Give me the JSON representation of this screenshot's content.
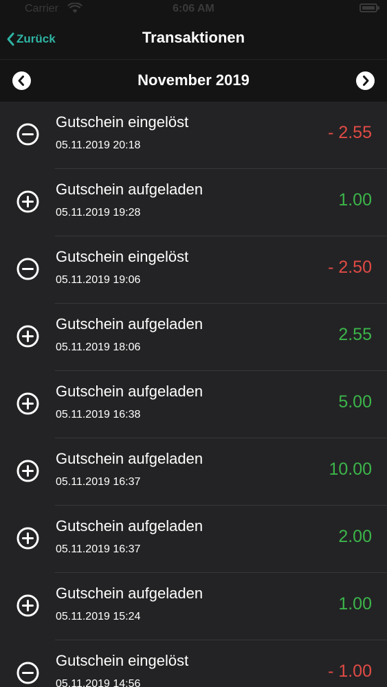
{
  "status_bar": {
    "carrier": "Carrier",
    "time": "6:06 AM"
  },
  "nav": {
    "back_label": "Zurück",
    "title": "Transaktionen"
  },
  "month_selector": {
    "label": "November 2019"
  },
  "colors": {
    "accent": "#2fb5a5",
    "negative": "#e14b45",
    "positive": "#3cb54a",
    "background": "#232325",
    "bar_background": "#141414"
  },
  "transactions": [
    {
      "title": "Gutschein eingelöst",
      "date": "05.11.2019 20:18",
      "amount": "- 2.55",
      "type": "debit",
      "icon": "minus-circle-icon"
    },
    {
      "title": "Gutschein aufgeladen",
      "date": "05.11.2019 19:28",
      "amount": "1.00",
      "type": "credit",
      "icon": "plus-circle-icon"
    },
    {
      "title": "Gutschein eingelöst",
      "date": "05.11.2019 19:06",
      "amount": "- 2.50",
      "type": "debit",
      "icon": "minus-circle-icon"
    },
    {
      "title": "Gutschein aufgeladen",
      "date": "05.11.2019 18:06",
      "amount": "2.55",
      "type": "credit",
      "icon": "plus-circle-icon"
    },
    {
      "title": "Gutschein aufgeladen",
      "date": "05.11.2019 16:38",
      "amount": "5.00",
      "type": "credit",
      "icon": "plus-circle-icon"
    },
    {
      "title": "Gutschein aufgeladen",
      "date": "05.11.2019 16:37",
      "amount": "10.00",
      "type": "credit",
      "icon": "plus-circle-icon"
    },
    {
      "title": "Gutschein aufgeladen",
      "date": "05.11.2019 16:37",
      "amount": "2.00",
      "type": "credit",
      "icon": "plus-circle-icon"
    },
    {
      "title": "Gutschein aufgeladen",
      "date": "05.11.2019 15:24",
      "amount": "1.00",
      "type": "credit",
      "icon": "plus-circle-icon"
    },
    {
      "title": "Gutschein eingelöst",
      "date": "05.11.2019 14:56",
      "amount": "- 1.00",
      "type": "debit",
      "icon": "minus-circle-icon"
    }
  ]
}
